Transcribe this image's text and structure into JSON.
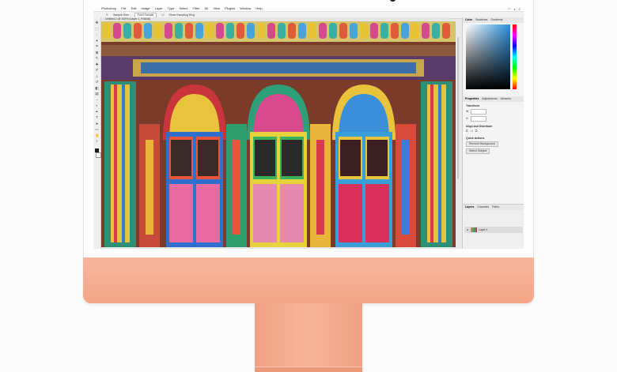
{
  "menubar": {
    "items": [
      "Photoshop",
      "File",
      "Edit",
      "Image",
      "Layer",
      "Type",
      "Select",
      "Filter",
      "3D",
      "View",
      "Plugins",
      "Window",
      "Help"
    ]
  },
  "options_bar": {
    "sample_label": "Sample Size:",
    "sample_value": "Point Sample",
    "show_ring_label": "Show Sampling Ring"
  },
  "document": {
    "tab_title": "Untitled-1 @ 100% (Layer 1, RGB/8)"
  },
  "panels": {
    "tabs": [
      "Color",
      "Swatches",
      "Gradients"
    ],
    "properties_tabs": [
      "Properties",
      "Adjustments",
      "Libraries"
    ],
    "properties": {
      "section_transform": "Transform",
      "w_label": "W",
      "h_label": "H",
      "section_align": "Align and Distribute",
      "section_quick": "Quick Actions",
      "btn_remove_bg": "Remove Background",
      "btn_select_subject": "Select Subject"
    },
    "layers_tabs": [
      "Layers",
      "Channels",
      "Paths"
    ],
    "layer_name": "Layer 1"
  },
  "colors": {
    "chassis_accent": "#f4a587",
    "foreground": "#1c1c1c",
    "background": "#ffffff"
  }
}
